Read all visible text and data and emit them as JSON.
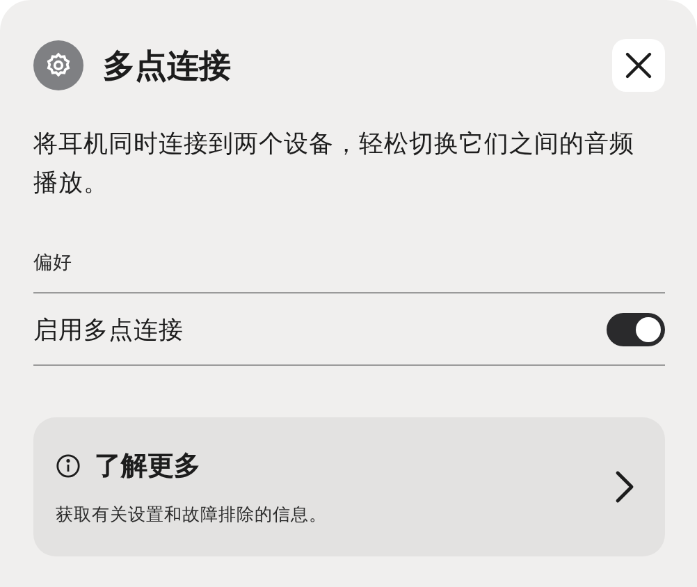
{
  "header": {
    "title": "多点连接"
  },
  "description": "将耳机同时连接到两个设备，轻松切换它们之间的音频播放。",
  "section_label": "偏好",
  "settings": [
    {
      "kind": "toggle",
      "label": "启用多点连接",
      "on": true
    }
  ],
  "learn_more": {
    "title": "了解更多",
    "subtitle": "获取有关设置和故障排除的信息。"
  }
}
